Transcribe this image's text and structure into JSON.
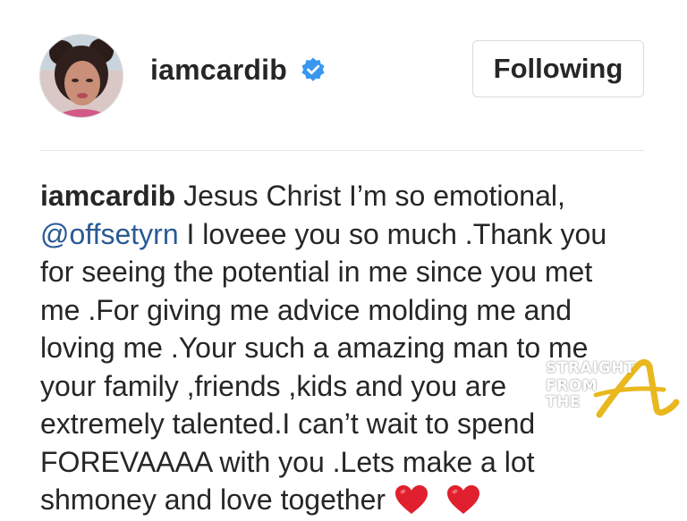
{
  "post": {
    "username": "iamcardib",
    "follow_label": "Following",
    "verified_color": "#3897f0",
    "caption_username": "iamcardib",
    "caption_lines": [
      "Jesus Christ I’m so emotional,",
      "@offsetyrn",
      "I loveee you so much .Thank you",
      "for seeing the potential in me since you met",
      "me .For giving me advice molding me and",
      "loving me .Your such a amazing man to me",
      "your family ,friends ,kids and you are",
      "extremely talented.I can’t wait to spend",
      "FOREVAAAA with you .Lets make a lot",
      "shmoney and love together"
    ],
    "mention_color": "#2a5a95",
    "heart_color": "#e0202e",
    "hearts": [
      "heart-icon",
      "heart-icon"
    ]
  },
  "watermark": {
    "line1": "STRAIGHT",
    "line2": "FROM",
    "line3": "THE",
    "logo_letter": "A",
    "logo_color": "#e8b81e"
  }
}
